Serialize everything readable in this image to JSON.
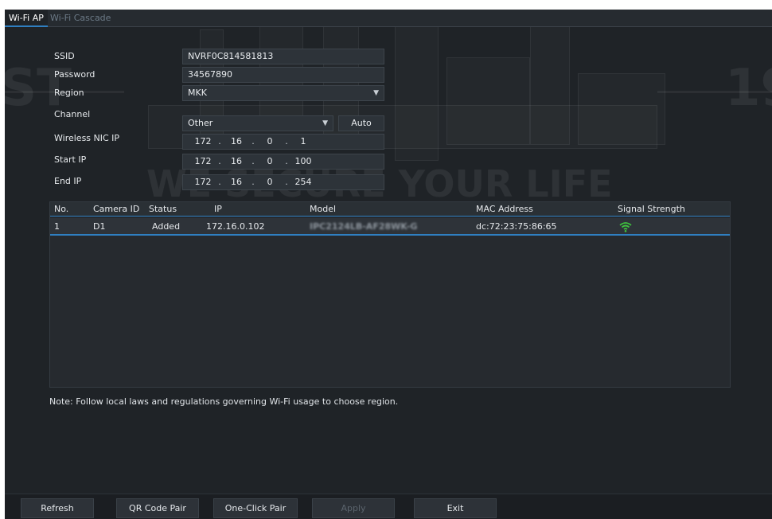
{
  "tabs": [
    {
      "label": "Wi-Fi AP",
      "active": true
    },
    {
      "label": "Wi-Fi Cascade",
      "active": false
    }
  ],
  "form": {
    "ssid_label": "SSID",
    "ssid_value": "NVRF0C814581813",
    "password_label": "Password",
    "password_value": "34567890",
    "region_label": "Region",
    "region_value": "MKK",
    "channel_label": "Channel",
    "channel_value": "Other",
    "channel_auto_label": "Auto",
    "nic_ip_label": "Wireless NIC IP",
    "nic_ip": [
      "172",
      "16",
      "0",
      "1"
    ],
    "start_ip_label": "Start IP",
    "start_ip": [
      "172",
      "16",
      "0",
      "100"
    ],
    "end_ip_label": "End IP",
    "end_ip": [
      "172",
      "16",
      "0",
      "254"
    ]
  },
  "table": {
    "headers": [
      "No.",
      "Camera ID",
      "Status",
      "IP",
      "Model",
      "MAC Address",
      "Signal Strength"
    ],
    "rows": [
      {
        "no": "1",
        "camera_id": "D1",
        "status": "Added",
        "ip": "172.16.0.102",
        "model": "IPC2124LB-AF28WK-G",
        "mac": "dc:72:23:75:86:65",
        "signal_icon": "wifi-signal-icon"
      }
    ]
  },
  "note": "Note: Follow local laws and regulations governing Wi-Fi usage to choose region.",
  "toolbar": {
    "refresh": "Refresh",
    "qr_pair": "QR Code Pair",
    "one_click_pair": "One-Click Pair",
    "apply": "Apply",
    "exit": "Exit"
  },
  "watermark": {
    "left": "ST",
    "right": "19",
    "slogan": "WE SECURE YOUR LIFE"
  },
  "colors": {
    "accent": "#2f7fc1",
    "signal": "#3fc33f",
    "background": "#1f2327"
  }
}
